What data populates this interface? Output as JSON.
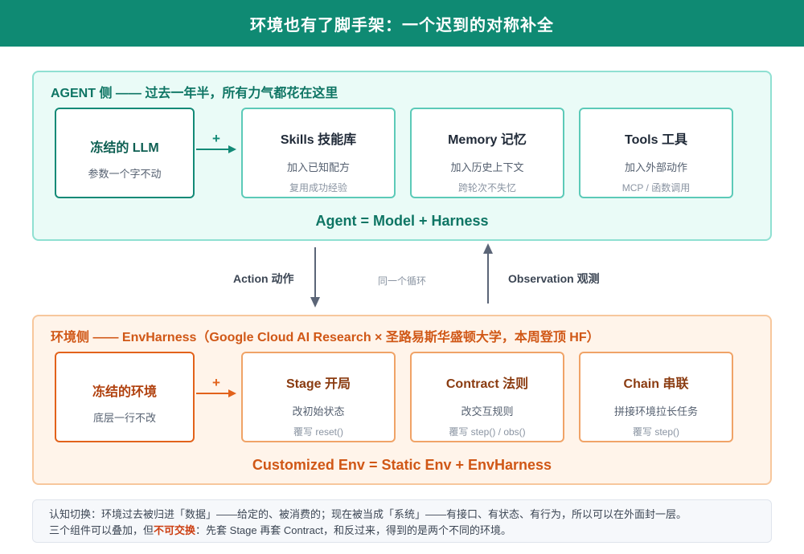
{
  "banner": {
    "title": "环境也有了脚手架：一个迟到的对称补全"
  },
  "agent": {
    "heading": "AGENT 侧 —— 过去一年半，所有力气都花在这里",
    "frozen": {
      "title": "冻结的 LLM",
      "line1": "参数一个字不动"
    },
    "plus": "+",
    "cards": [
      {
        "title": "Skills 技能库",
        "line1": "加入已知配方",
        "line2": "复用成功经验"
      },
      {
        "title": "Memory 记忆",
        "line1": "加入历史上下文",
        "line2": "跨轮次不失忆"
      },
      {
        "title": "Tools 工具",
        "line1": "加入外部动作",
        "line2": "MCP / 函数调用"
      }
    ],
    "formula": "Agent = Model + Harness"
  },
  "middle": {
    "action": "Action 动作",
    "loop": "同一个循环",
    "observation": "Observation 观测"
  },
  "env": {
    "heading": "环境侧 —— EnvHarness（Google Cloud AI Research × 圣路易斯华盛顿大学，本周登顶 HF）",
    "frozen": {
      "title": "冻结的环境",
      "line1": "底层一行不改"
    },
    "plus": "+",
    "cards": [
      {
        "title": "Stage 开局",
        "line1": "改初始状态",
        "line2": "覆写 reset()"
      },
      {
        "title": "Contract 法则",
        "line1": "改交互规则",
        "line2": "覆写 step() / obs()"
      },
      {
        "title": "Chain 串联",
        "line1": "拼接环境拉长任务",
        "line2": "覆写 step()"
      }
    ],
    "formula": "Customized Env = Static Env + EnvHarness"
  },
  "note": {
    "line1": "认知切换：环境过去被归进「数据」——给定的、被消费的；现在被当成「系统」——有接口、有状态、有行为，所以可以在外面封一层。",
    "line2_before": "三个组件可以叠加，但",
    "line2_em": "不可交换",
    "line2_after": "：先套 Stage 再套 Contract，和反过来，得到的是两个不同的环境。"
  },
  "colors": {
    "banner": "#0f8a73",
    "agent_accent": "#0e7564",
    "env_accent": "#d05716",
    "arrow": "#5b6577"
  }
}
